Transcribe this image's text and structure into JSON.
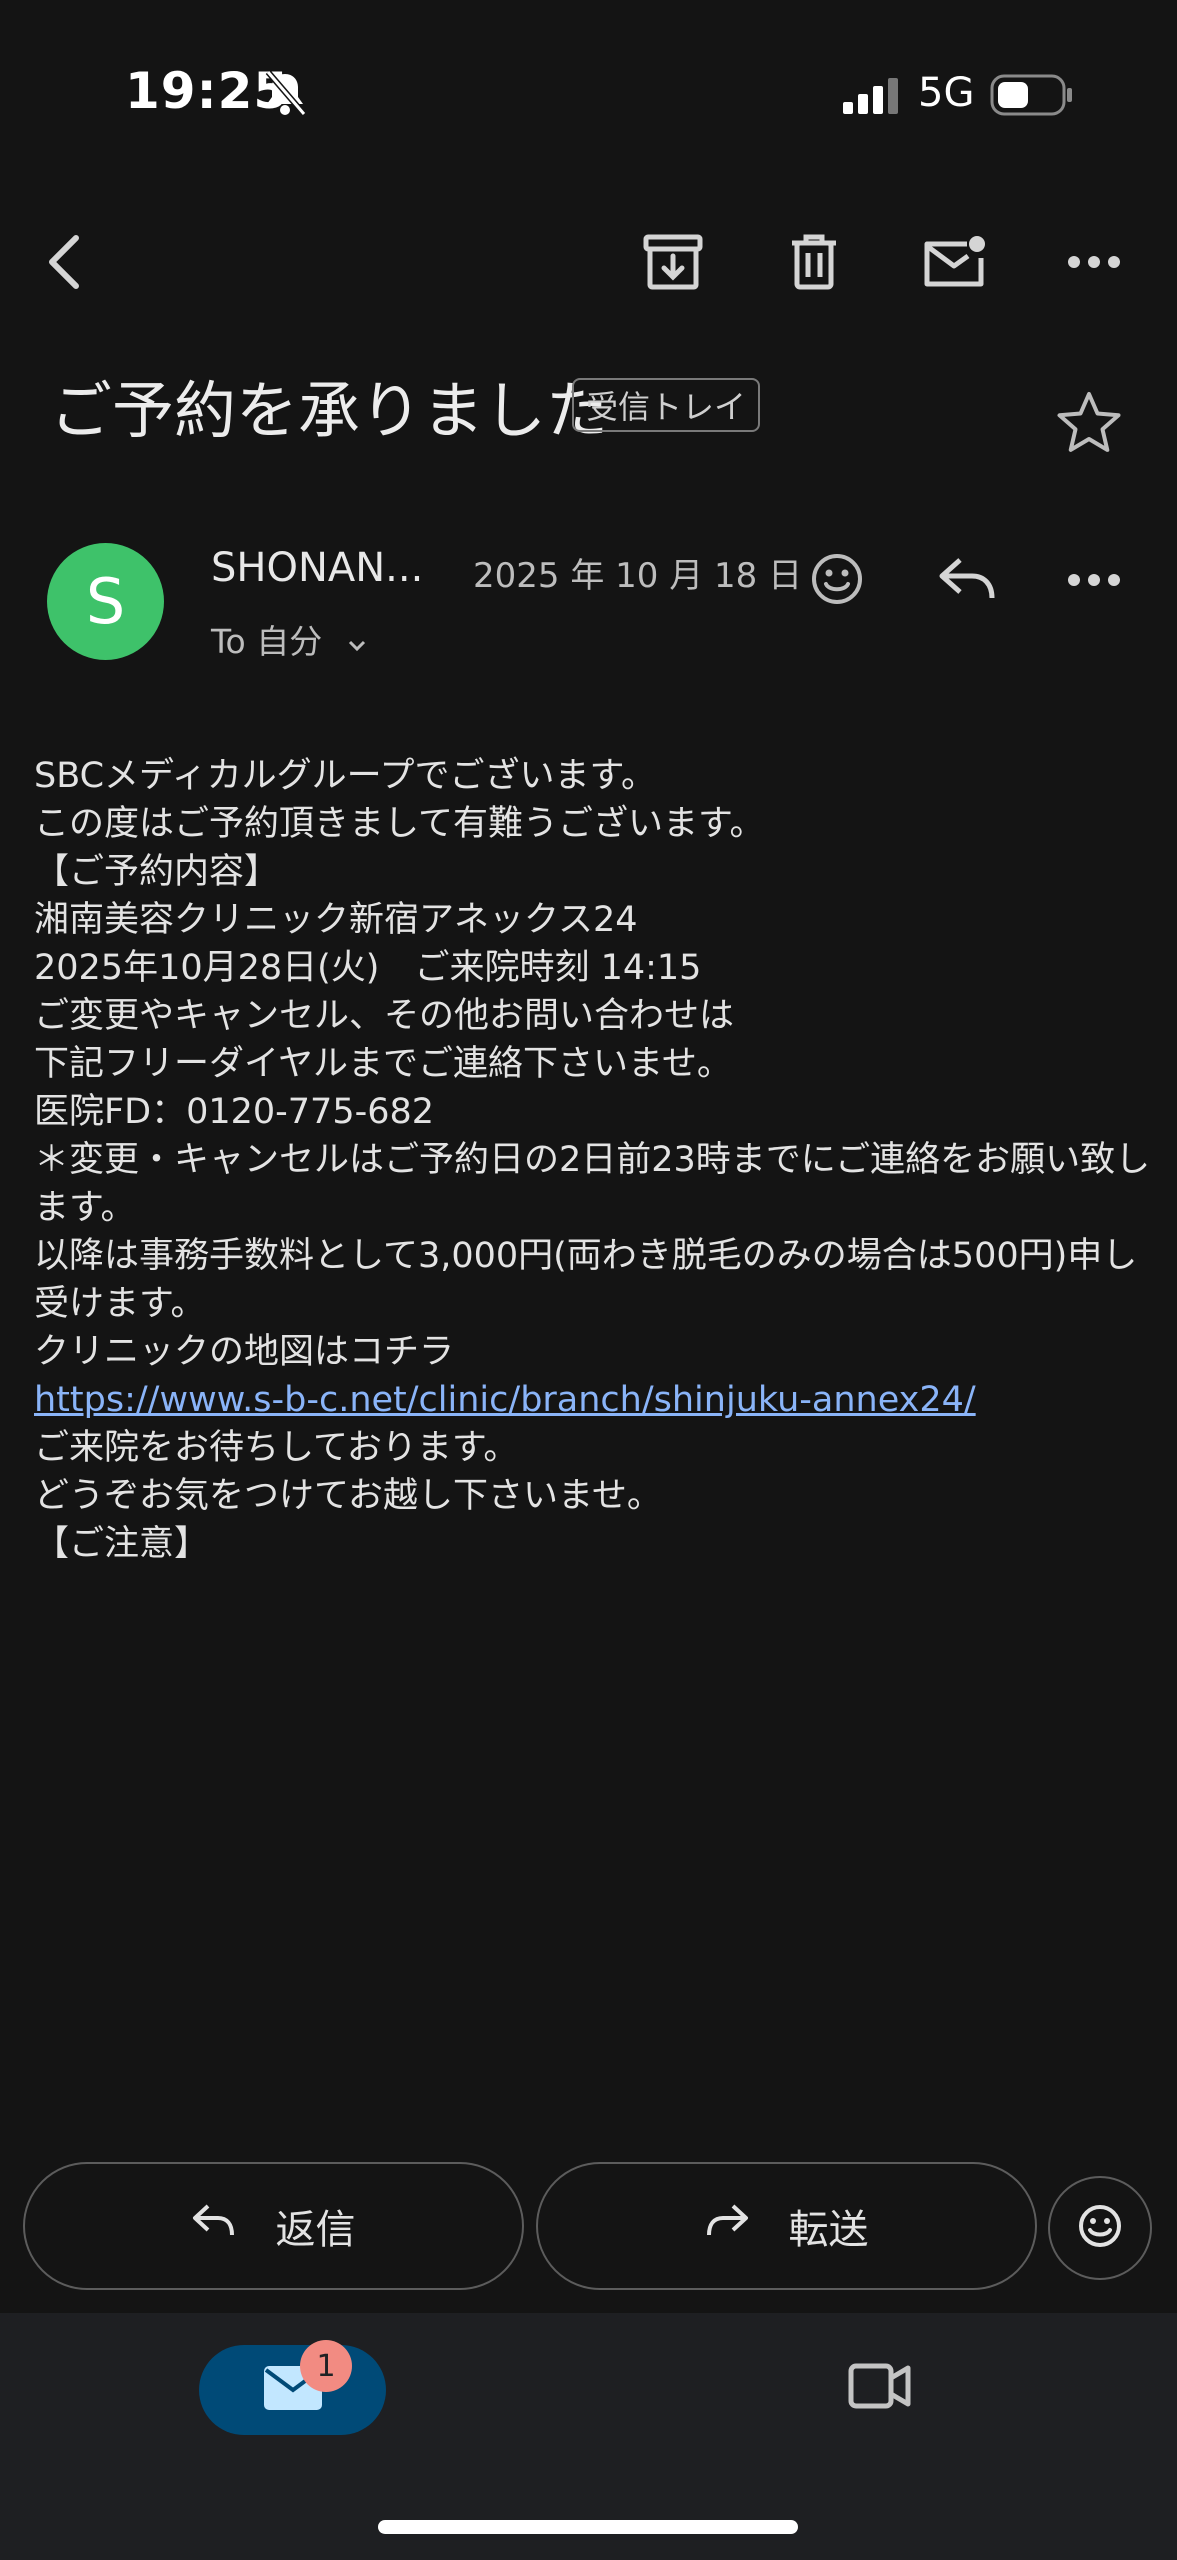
{
  "status_bar": {
    "time": "19:25",
    "network": "5G"
  },
  "email": {
    "subject": "ご予約を承りました",
    "label": "受信トレイ",
    "sender_initial": "S",
    "sender": "SHONAN...",
    "date": "2025 年 10 月 18 日",
    "to": "To 自分",
    "body": [
      "SBCメディカルグループでございます。\nこの度はご予約頂きまして有難うございます。",
      "",
      "【ご予約内容】\n湘南美容クリニック新宿アネックス24\n2025年10月28日(火)　ご来院時刻 14:15",
      "",
      "",
      "",
      "ご変更やキャンセル、その他お問い合わせは\n下記フリーダイヤルまでご連絡下さいませ。\n医院FD：0120-775-682",
      "",
      "＊変更・キャンセルはご予約日の2日前23時までにご連絡をお願い致します。\n以降は事務手数料として3,000円(両わき脱毛のみの場合は500円)申し受けます。",
      "",
      "",
      "クリニックの地図はコチラ"
    ],
    "link": "https://www.s-b-c.net/clinic/branch/shinjuku-annex24/",
    "body_after": [
      "",
      "",
      "",
      "ご来院をお待ちしております。\nどうぞお気をつけてお越し下さいませ。",
      "",
      "",
      "【ご注意】"
    ]
  },
  "actions": {
    "reply": "返信",
    "forward": "転送"
  },
  "nav": {
    "mail_badge": "1"
  }
}
